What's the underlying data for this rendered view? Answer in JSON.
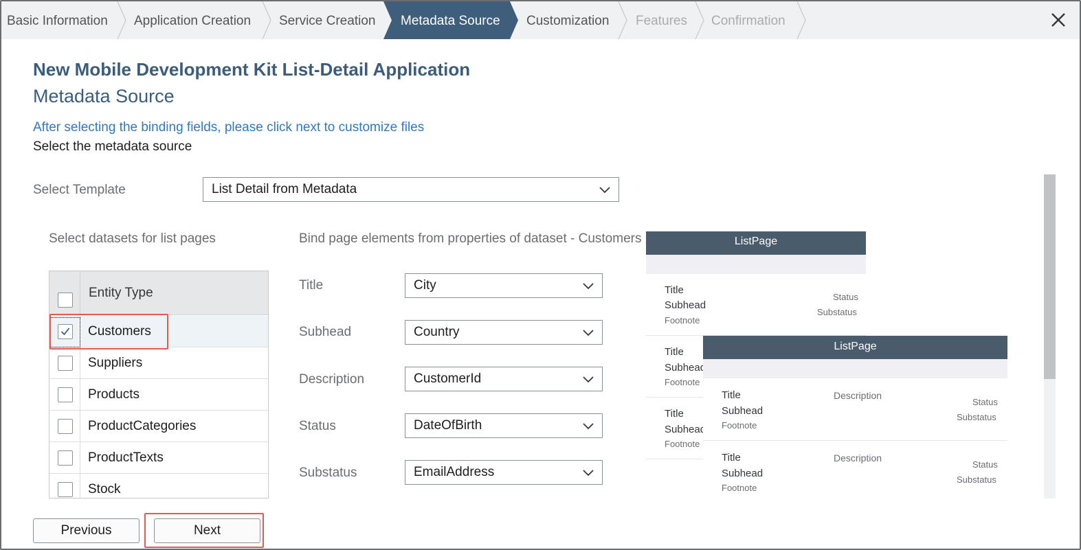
{
  "wizard": {
    "steps": [
      {
        "label": "Basic Information",
        "state": "done"
      },
      {
        "label": "Application Creation",
        "state": "done"
      },
      {
        "label": "Service Creation",
        "state": "done"
      },
      {
        "label": "Metadata Source",
        "state": "active"
      },
      {
        "label": "Customization",
        "state": "done"
      },
      {
        "label": "Features",
        "state": "disabled"
      },
      {
        "label": "Confirmation",
        "state": "disabled"
      }
    ],
    "close_icon": "close-icon"
  },
  "page": {
    "title": "New Mobile Development Kit List-Detail Application",
    "subtitle": "Metadata Source",
    "hint": "After selecting the binding fields, please click next to customize files",
    "instruction": "Select the metadata source"
  },
  "template": {
    "label": "Select Template",
    "value": "List Detail from Metadata"
  },
  "datasets": {
    "label": "Select datasets for list pages",
    "header": "Entity Type",
    "rows": [
      {
        "name": "Customers",
        "checked": true
      },
      {
        "name": "Suppliers",
        "checked": false
      },
      {
        "name": "Products",
        "checked": false
      },
      {
        "name": "ProductCategories",
        "checked": false
      },
      {
        "name": "ProductTexts",
        "checked": false
      },
      {
        "name": "Stock",
        "checked": false
      }
    ]
  },
  "bindings": {
    "label": "Bind page elements from properties of dataset - Customers",
    "fields": [
      {
        "label": "Title",
        "value": "City"
      },
      {
        "label": "Subhead",
        "value": "Country"
      },
      {
        "label": "Description",
        "value": "CustomerId"
      },
      {
        "label": "Status",
        "value": "DateOfBirth"
      },
      {
        "label": "Substatus",
        "value": "EmailAddress"
      }
    ]
  },
  "preview": {
    "back_header": "ListPage",
    "front_header": "ListPage",
    "item": {
      "title": "Title",
      "subhead": "Subhead",
      "footnote": "Footnote",
      "description": "Description",
      "status": "Status",
      "substatus": "Substatus"
    }
  },
  "footer": {
    "previous": "Previous",
    "next": "Next"
  },
  "colors": {
    "accent": "#3b5c7b",
    "active_step": "#3f5e7c",
    "link": "#2f78c4",
    "highlight": "#e05a4f",
    "preview_header": "#4a5b6c"
  }
}
